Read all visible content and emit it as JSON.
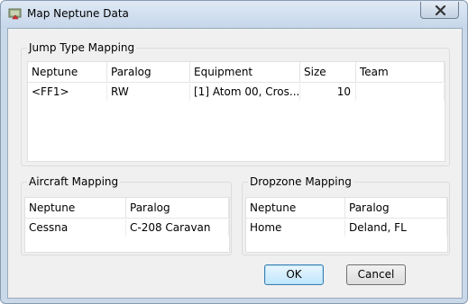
{
  "window": {
    "title": "Map Neptune Data"
  },
  "jump_type_mapping": {
    "label": "Jump Type Mapping",
    "columns": [
      "Neptune",
      "Paralog",
      "Equipment",
      "Size",
      "Team"
    ],
    "rows": [
      [
        "<FF1>",
        "RW",
        "[1] Atom 00, Cros...",
        "10",
        ""
      ]
    ]
  },
  "aircraft_mapping": {
    "label": "Aircraft Mapping",
    "columns": [
      "Neptune",
      "Paralog"
    ],
    "rows": [
      [
        "Cessna",
        "C-208 Caravan"
      ]
    ]
  },
  "dropzone_mapping": {
    "label": "Dropzone Mapping",
    "columns": [
      "Neptune",
      "Paralog"
    ],
    "rows": [
      [
        "Home",
        "Deland, FL"
      ]
    ]
  },
  "buttons": {
    "ok": "OK",
    "cancel": "Cancel"
  },
  "icons": {
    "app": "map-app-icon",
    "close": "close-icon"
  }
}
